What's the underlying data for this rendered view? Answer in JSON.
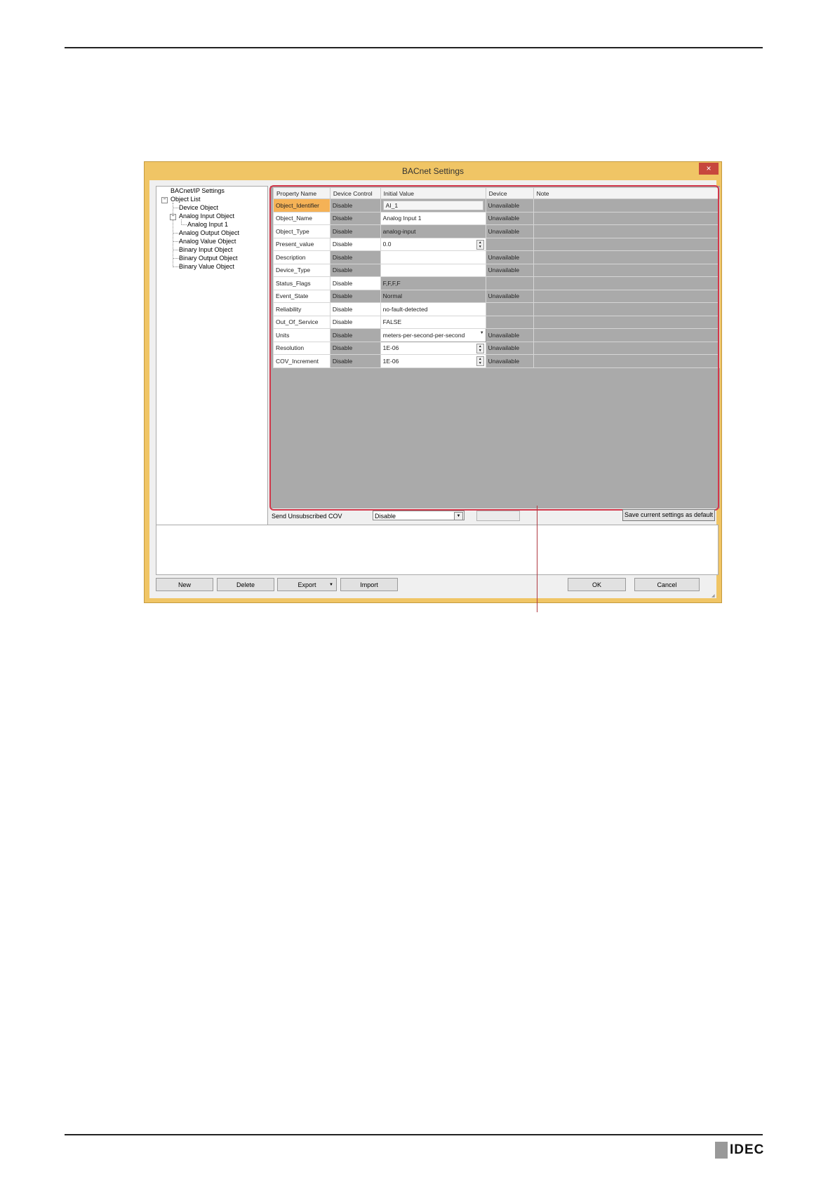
{
  "dialog": {
    "title": "BACnet Settings",
    "close_glyph": "×"
  },
  "tree": {
    "root_label": "BACnet/IP Settings",
    "object_list": "Object List",
    "items": {
      "device": "Device Object",
      "analog_input": "Analog Input Object",
      "analog_input_1": "Analog Input 1",
      "analog_output": "Analog Output Object",
      "analog_value": "Analog Value Object",
      "binary_input": "Binary Input Object",
      "binary_output": "Binary Output Object",
      "binary_value": "Binary Value Object"
    }
  },
  "grid": {
    "headers": [
      "Property Name",
      "Device Control",
      "Initial Value",
      "Device",
      "Note"
    ],
    "rows": [
      {
        "name": "Object_Identifier",
        "control": "Disable",
        "value": "AI_1",
        "device": "Unavailable"
      },
      {
        "name": "Object_Name",
        "control": "Disable",
        "value": "Analog Input 1",
        "device": "Unavailable"
      },
      {
        "name": "Object_Type",
        "control": "Disable",
        "value": "analog-input",
        "device": "Unavailable"
      },
      {
        "name": "Present_value",
        "control": "Disable",
        "value": "0.0",
        "device": ""
      },
      {
        "name": "Description",
        "control": "Disable",
        "value": "",
        "device": "Unavailable"
      },
      {
        "name": "Device_Type",
        "control": "Disable",
        "value": "",
        "device": "Unavailable"
      },
      {
        "name": "Status_Flags",
        "control": "Disable",
        "value": "F,F,F,F",
        "device": ""
      },
      {
        "name": "Event_State",
        "control": "Disable",
        "value": "Normal",
        "device": "Unavailable"
      },
      {
        "name": "Reliability",
        "control": "Disable",
        "value": "no-fault-detected",
        "device": ""
      },
      {
        "name": "Out_Of_Service",
        "control": "Disable",
        "value": "FALSE",
        "device": ""
      },
      {
        "name": "Units",
        "control": "Disable",
        "value": "meters-per-second-per-second",
        "device": "Unavailable"
      },
      {
        "name": "Resolution",
        "control": "Disable",
        "value": "1E-06",
        "device": "Unavailable"
      },
      {
        "name": "COV_Increment",
        "control": "Disable",
        "value": "1E-06",
        "device": "Unavailable"
      }
    ]
  },
  "cov": {
    "label": "Send Unsubscribed COV",
    "value": "Disable"
  },
  "buttons": {
    "save_default": "Save current settings as default",
    "new": "New",
    "delete": "Delete",
    "export": "Export",
    "import": "Import",
    "ok": "OK",
    "cancel": "Cancel"
  },
  "footer": {
    "logo": "IDEC"
  },
  "colors": {
    "dialog_frame": "#f0c565",
    "selected_cell": "#f5b256",
    "callout": "#d1374a",
    "disabled_cell": "#aaaaaa"
  }
}
